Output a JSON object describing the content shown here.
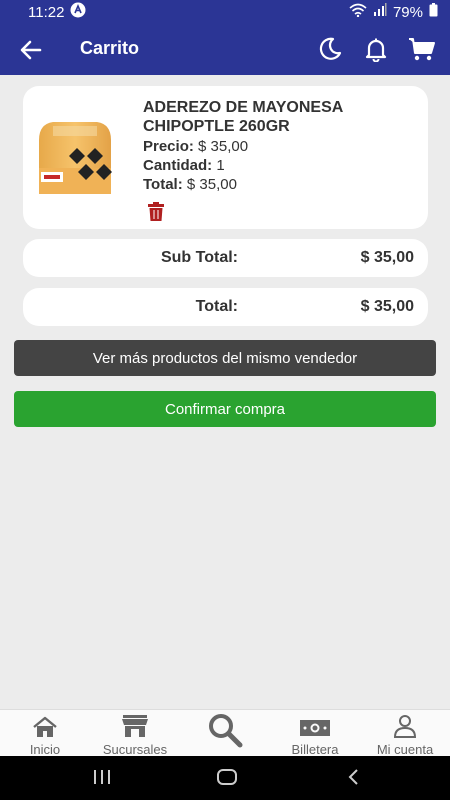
{
  "status": {
    "time": "11:22",
    "battery": "79%"
  },
  "appbar": {
    "title": "Carrito"
  },
  "product": {
    "name": "ADEREZO DE MAYONESA CHIPOPTLE 260GR",
    "price_label": "Precio:",
    "price_value": "$ 35,00",
    "qty_label": "Cantidad:",
    "qty_value": "1",
    "total_label": "Total:",
    "total_value": "$ 35,00"
  },
  "subtotal": {
    "label": "Sub Total:",
    "value": "$ 35,00"
  },
  "total": {
    "label": "Total:",
    "value": "$ 35,00"
  },
  "buttons": {
    "more_products": "Ver más productos del mismo vendedor",
    "confirm": "Confirmar compra"
  },
  "nav": [
    {
      "label": "Inicio",
      "icon": "home-icon"
    },
    {
      "label": "Sucursales",
      "icon": "store-icon"
    },
    {
      "label": "",
      "icon": "search-icon"
    },
    {
      "label": "Billetera",
      "icon": "wallet-icon"
    },
    {
      "label": "Mi cuenta",
      "icon": "user-icon"
    }
  ],
  "colors": {
    "appbar": "#2b3595",
    "confirm": "#2aa330",
    "dark_button": "#444444",
    "trash": "#b02020"
  }
}
